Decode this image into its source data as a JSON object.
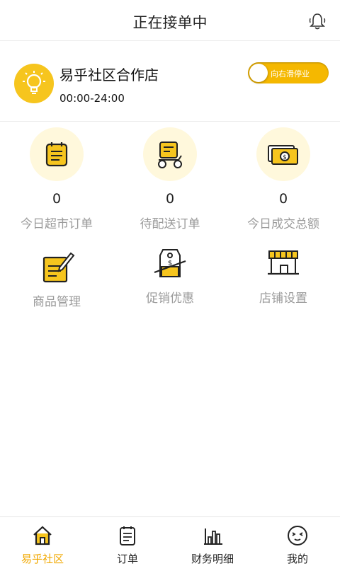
{
  "header": {
    "title": "正在接单中",
    "icon": "bell-icon"
  },
  "store": {
    "name": "易乎社区合作店",
    "hours": "00:00-24:00",
    "logo_icon": "lightbulb-icon",
    "toggle_label": "向右滑停业"
  },
  "stats": [
    {
      "value": "0",
      "label": "今日超市订单",
      "icon": "notepad-icon"
    },
    {
      "value": "0",
      "label": "待配送订单",
      "icon": "delivery-scooter-icon"
    },
    {
      "value": "0",
      "label": "今日成交总额",
      "icon": "money-bills-icon"
    }
  ],
  "tools": [
    {
      "label": "商品管理",
      "icon": "edit-note-icon"
    },
    {
      "label": "促销优惠",
      "icon": "price-tag-icon"
    },
    {
      "label": "店铺设置",
      "icon": "storefront-icon"
    }
  ],
  "tabs": [
    {
      "label": "易乎社区",
      "icon": "home-icon",
      "active": true
    },
    {
      "label": "订单",
      "icon": "order-list-icon",
      "active": false
    },
    {
      "label": "财务明细",
      "icon": "bar-chart-icon",
      "active": false
    },
    {
      "label": "我的",
      "icon": "smiley-face-icon",
      "active": false
    }
  ],
  "colors": {
    "accent": "#f6c51e",
    "active_tab": "#f1a800",
    "icon_bg": "#fff8dc"
  }
}
